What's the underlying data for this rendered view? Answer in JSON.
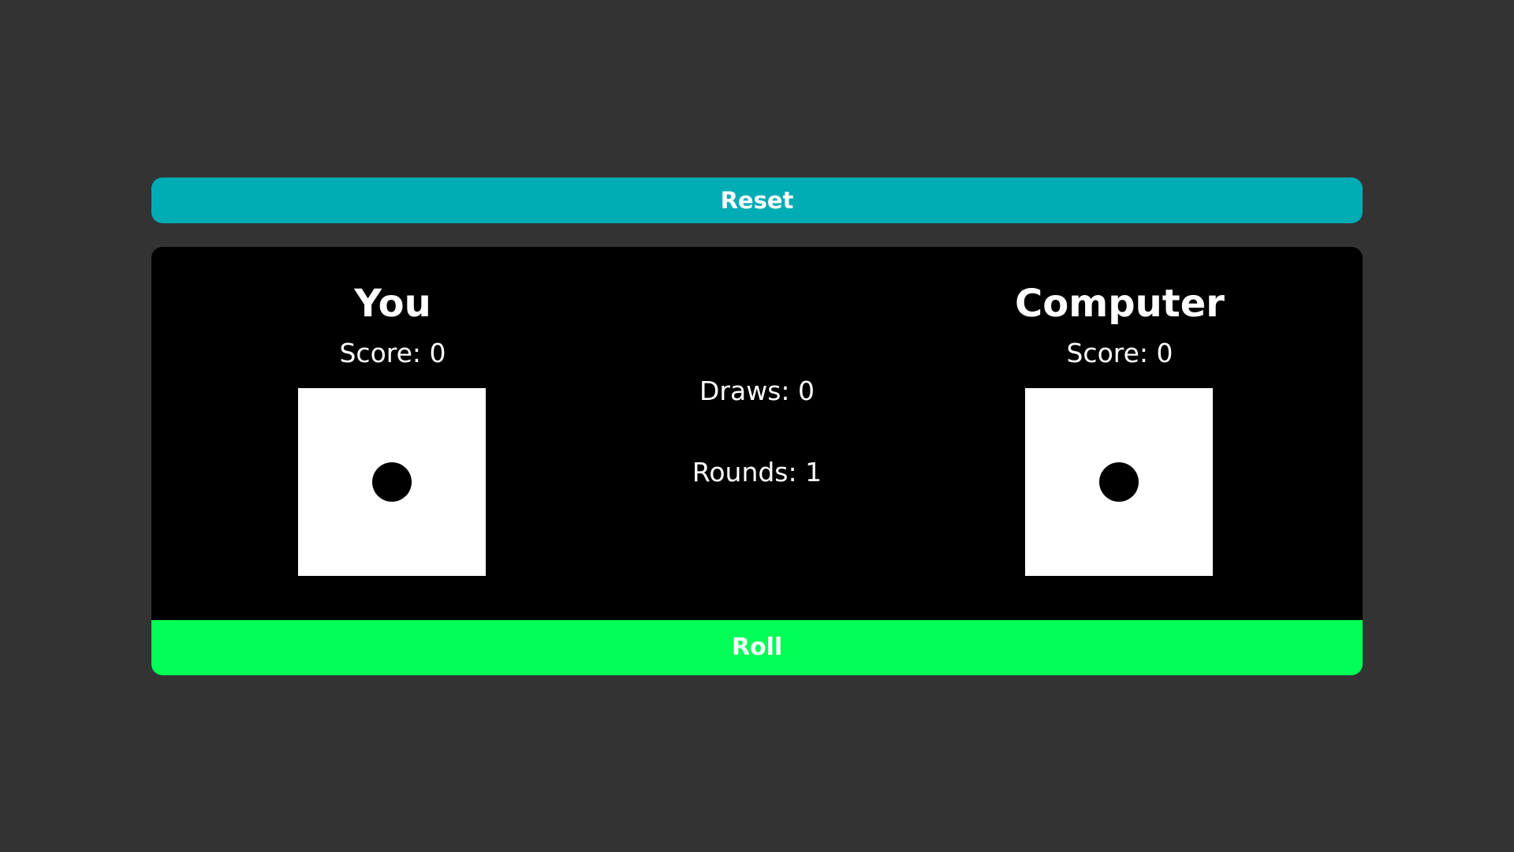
{
  "colors": {
    "background": "#333333",
    "panel": "#000000",
    "reset_button": "#00adb5",
    "roll_button": "#00ff57",
    "die_face": "#ffffff",
    "pip": "#000000",
    "text": "#ffffff"
  },
  "controls": {
    "reset_label": "Reset",
    "roll_label": "Roll"
  },
  "player": {
    "name": "You",
    "score_text": "Score: 0",
    "die_value": 1
  },
  "computer": {
    "name": "Computer",
    "score_text": "Score: 0",
    "die_value": 1
  },
  "stats": {
    "draws_text": "Draws: 0",
    "rounds_text": "Rounds: 1"
  }
}
